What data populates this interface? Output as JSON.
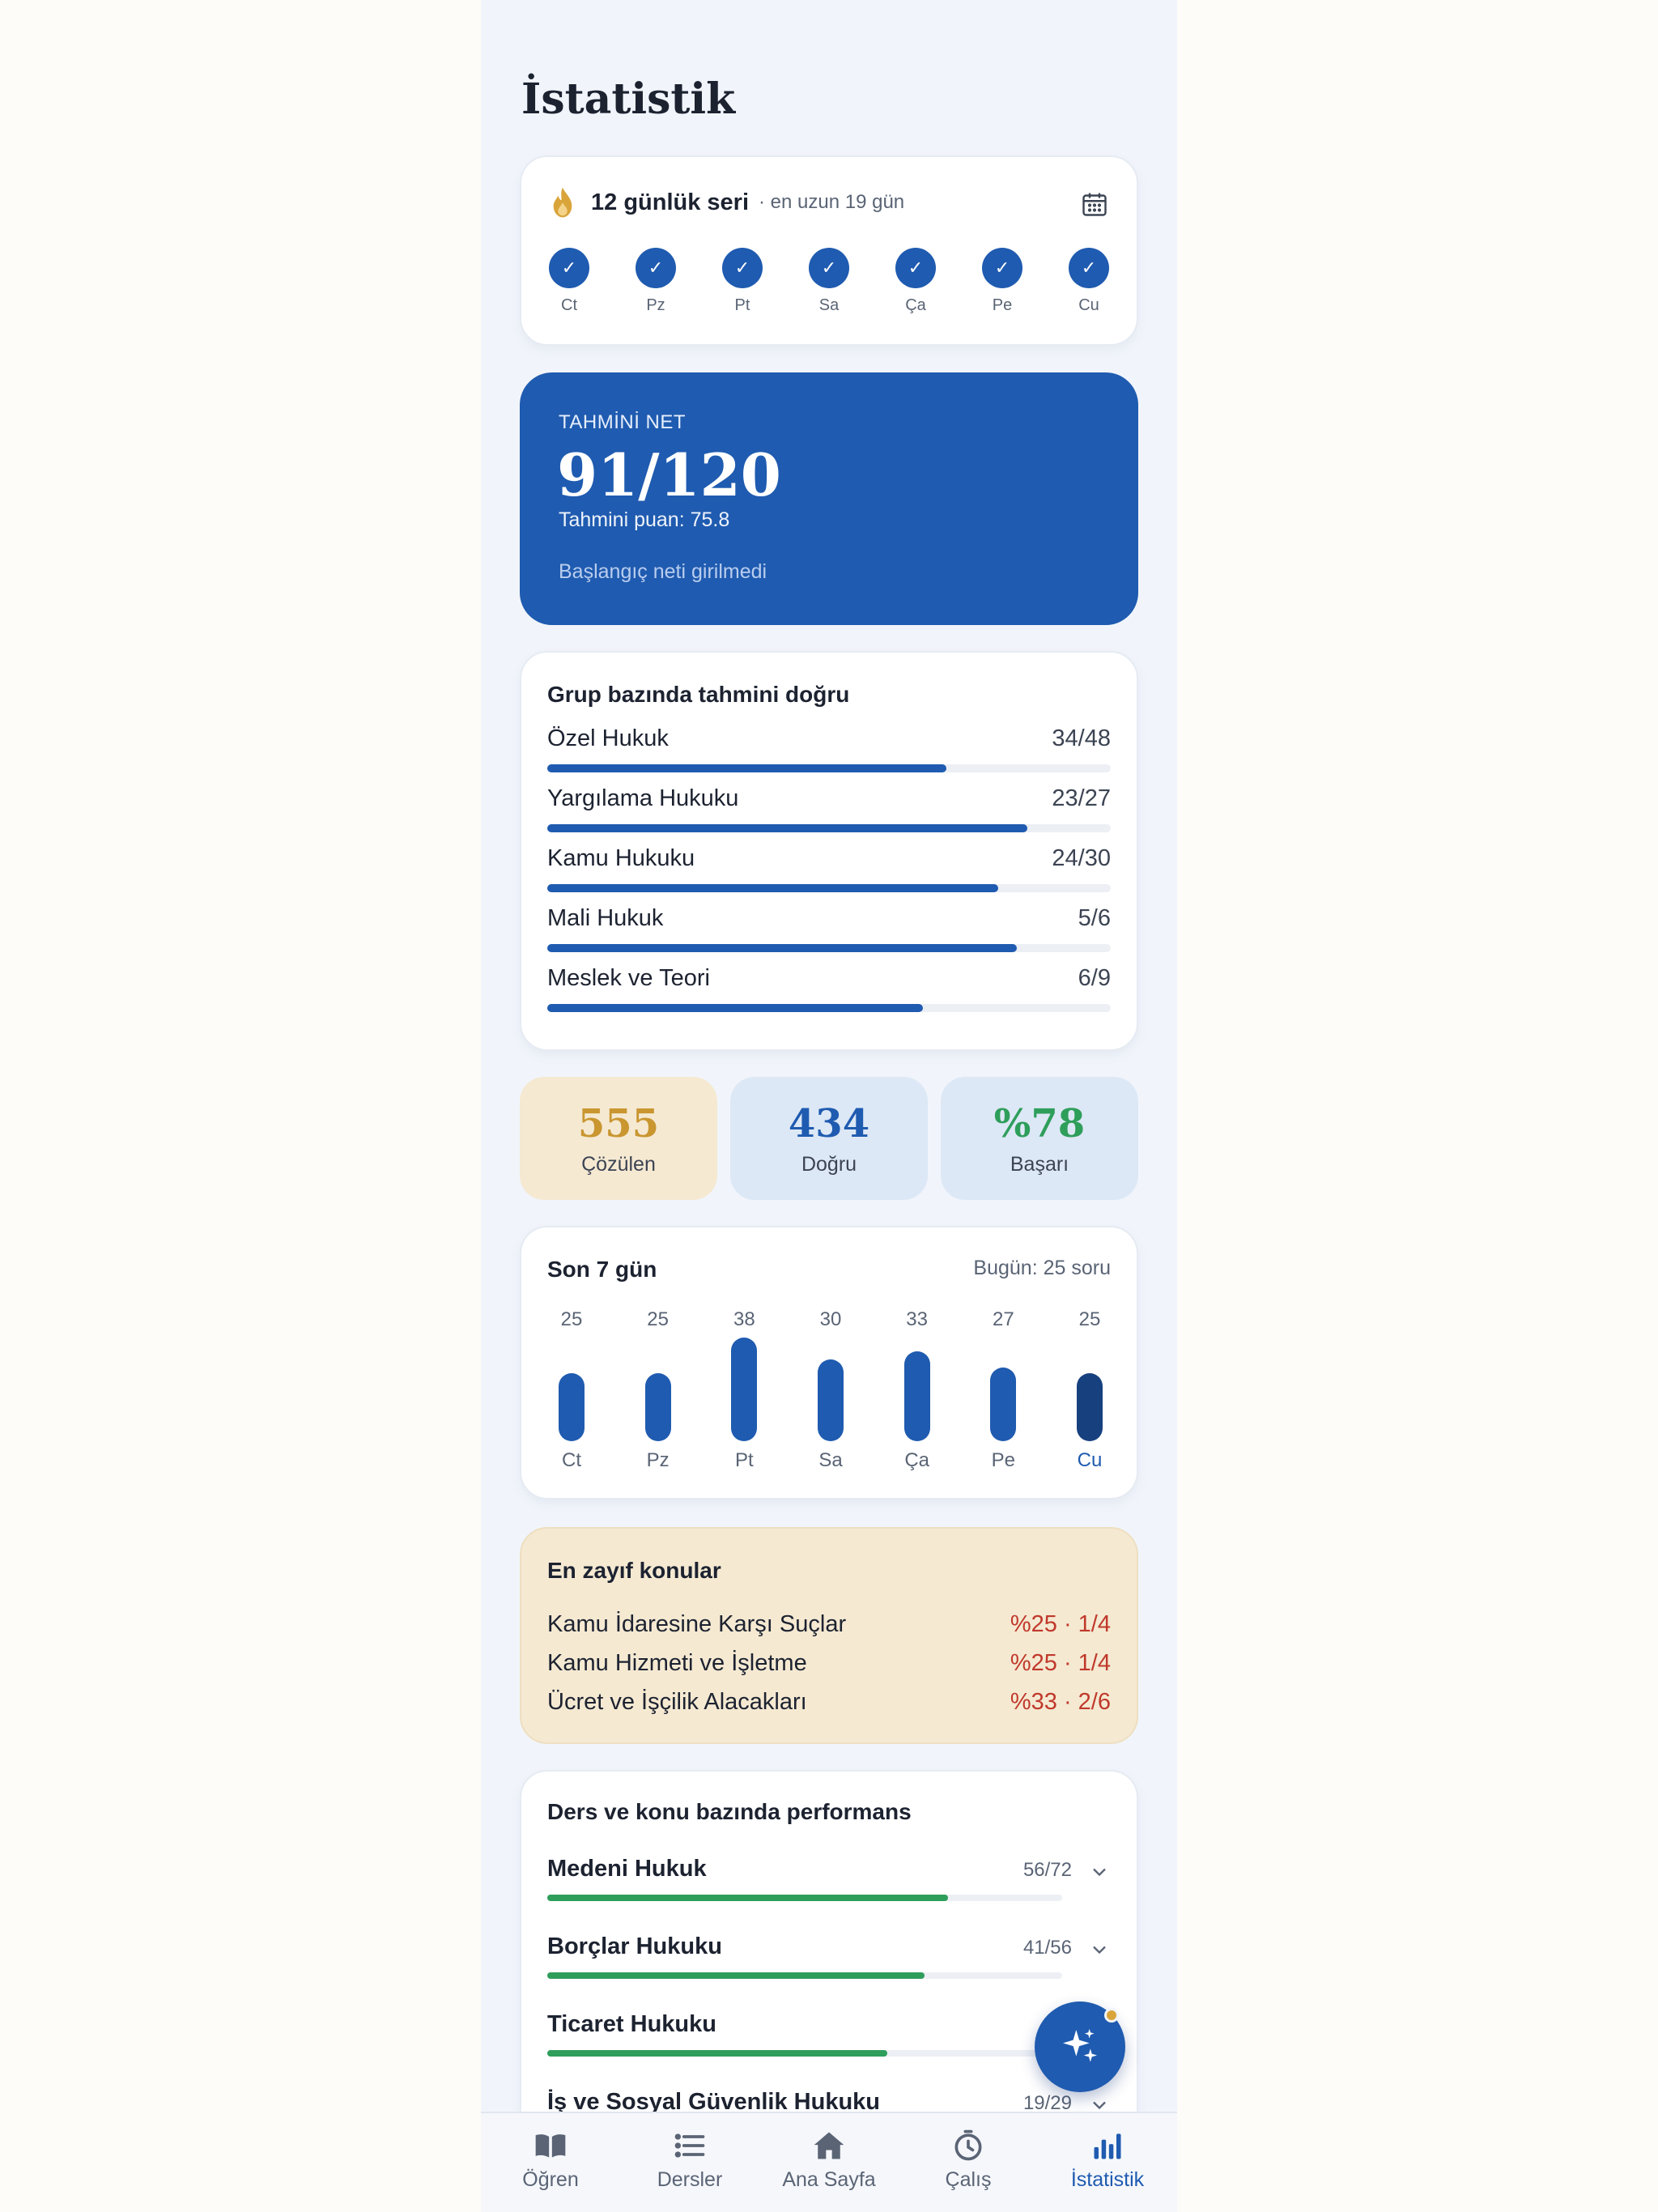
{
  "page": {
    "title": "İstatistik"
  },
  "streak": {
    "title": "12 günlük seri",
    "subtitle": "· en uzun 19 gün",
    "days": [
      {
        "label": "Ct",
        "done": true
      },
      {
        "label": "Pz",
        "done": true
      },
      {
        "label": "Pt",
        "done": true
      },
      {
        "label": "Sa",
        "done": true
      },
      {
        "label": "Ça",
        "done": true
      },
      {
        "label": "Pe",
        "done": true
      },
      {
        "label": "Cu",
        "done": true
      }
    ],
    "check_glyph": "✓"
  },
  "net": {
    "label": "TAHMİNİ NET",
    "value": "91/120",
    "score": "Tahmini puan: 75.8",
    "start_note": "Başlangıç neti girilmedi"
  },
  "groups": {
    "title": "Grup bazında tahmini doğru",
    "items": [
      {
        "name": "Özel Hukuk",
        "value": "34/48",
        "ratio": 0.708
      },
      {
        "name": "Yargılama Hukuku",
        "value": "23/27",
        "ratio": 0.852
      },
      {
        "name": "Kamu Hukuku",
        "value": "24/30",
        "ratio": 0.8
      },
      {
        "name": "Mali Hukuk",
        "value": "5/6",
        "ratio": 0.833
      },
      {
        "name": "Meslek ve Teori",
        "value": "6/9",
        "ratio": 0.667
      }
    ]
  },
  "stats": {
    "solved": {
      "value": "555",
      "label": "Çözülen",
      "color": "#c99630",
      "bg": "#f5e9d2"
    },
    "correct": {
      "value": "434",
      "label": "Doğru",
      "color": "#1f5bb0",
      "bg": "#dde8f6"
    },
    "success": {
      "value": "%78",
      "label": "Başarı",
      "color": "#2e9e5b",
      "bg": "#dde8f6"
    }
  },
  "week": {
    "title": "Son 7 gün",
    "today": "Bugün: 25 soru",
    "chart_data": {
      "type": "bar",
      "categories": [
        "Ct",
        "Pz",
        "Pt",
        "Sa",
        "Ça",
        "Pe",
        "Cu"
      ],
      "values": [
        25,
        25,
        38,
        30,
        33,
        27,
        25
      ],
      "highlight_index": 6
    }
  },
  "weak": {
    "title": "En zayıf konular",
    "items": [
      {
        "name": "Kamu İdaresine Karşı Suçlar",
        "value": "%25 · 1/4"
      },
      {
        "name": "Kamu Hizmeti ve İşletme",
        "value": "%25 · 1/4"
      },
      {
        "name": "Ücret ve İşçilik Alacakları",
        "value": "%33 · 2/6"
      }
    ]
  },
  "performance": {
    "title": "Ders ve konu bazında performans",
    "items": [
      {
        "name": "Medeni Hukuk",
        "value": "56/72",
        "ratio": 0.778
      },
      {
        "name": "Borçlar Hukuku",
        "value": "41/56",
        "ratio": 0.732
      },
      {
        "name": "Ticaret Hukuku",
        "value": "36",
        "ratio": 0.66
      },
      {
        "name": "İş ve Sosyal Güvenlik Hukuku",
        "value": "19/29",
        "ratio": 0.655
      }
    ]
  },
  "nav": {
    "items": [
      {
        "label": "Öğren",
        "icon": "book-icon"
      },
      {
        "label": "Dersler",
        "icon": "list-icon"
      },
      {
        "label": "Ana Sayfa",
        "icon": "home-icon"
      },
      {
        "label": "Çalış",
        "icon": "timer-icon"
      },
      {
        "label": "İstatistik",
        "icon": "chart-icon",
        "active": true
      }
    ]
  },
  "colors": {
    "accent": "#1f5bb0",
    "green": "#2e9e5b",
    "gold": "#d9a43a",
    "danger": "#c0392b"
  }
}
